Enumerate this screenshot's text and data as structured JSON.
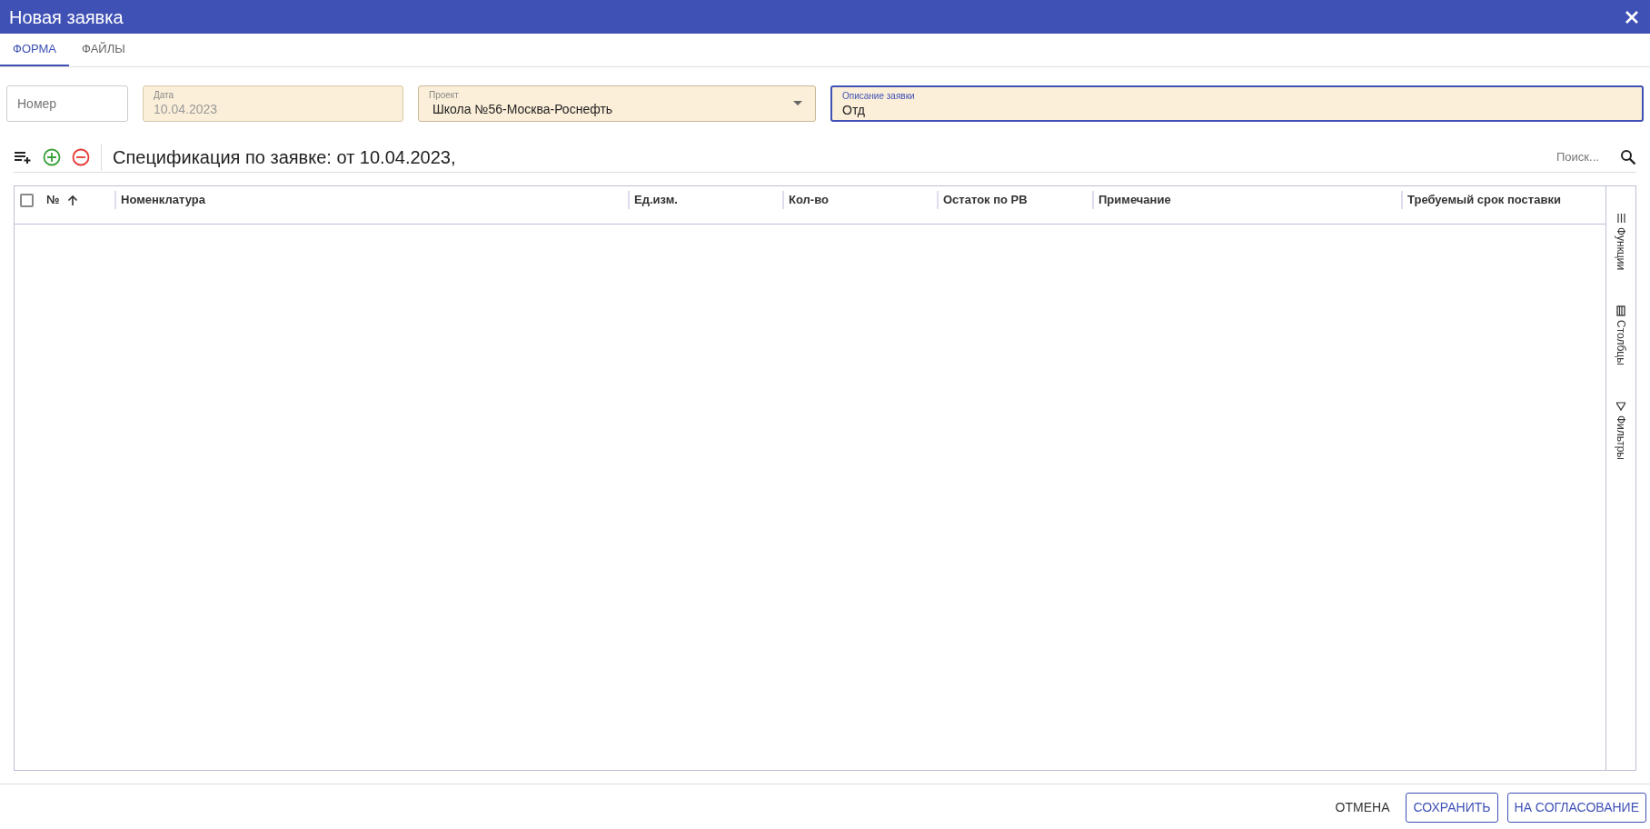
{
  "window": {
    "title": "Новая заявка"
  },
  "tabs": [
    {
      "label": "ФОРМА",
      "selected": true
    },
    {
      "label": "ФАЙЛЫ",
      "selected": false
    }
  ],
  "fields": [
    {
      "kind": "text",
      "placeholder": "Номер"
    },
    {
      "kind": "readonly",
      "label": "Дата",
      "value": "10.04.2023"
    },
    {
      "kind": "select",
      "label": "Проект",
      "value": "Школа №56-Москва-Роснефть"
    },
    {
      "kind": "focused",
      "label": "Описание заявки",
      "value": "Отд"
    }
  ],
  "spec_title": "Спецификация по заявке: от 10.04.2023,",
  "search": {
    "placeholder": "Поиск..."
  },
  "table": {
    "select_all_checked": false,
    "columns": [
      {
        "label": "№",
        "sorted_ascending": true
      },
      {
        "label": "Номенклатура"
      },
      {
        "label": "Ед.изм."
      },
      {
        "label": "Кол-во"
      },
      {
        "label": "Остаток по РВ"
      },
      {
        "label": "Примечание"
      },
      {
        "label": "Требуемый срок поставки"
      }
    ]
  },
  "side_panel": [
    {
      "kind": "functions",
      "label": "Функции"
    },
    {
      "kind": "columns",
      "label": "Столбцы"
    },
    {
      "kind": "filters",
      "label": "Фильтры"
    }
  ],
  "footer": [
    {
      "kind": "text",
      "label": "ОТМЕНА"
    },
    {
      "kind": "outline",
      "label": "СОХРАНИТЬ"
    },
    {
      "kind": "outline",
      "label": "НА СОГЛАСОВАНИЕ"
    }
  ]
}
